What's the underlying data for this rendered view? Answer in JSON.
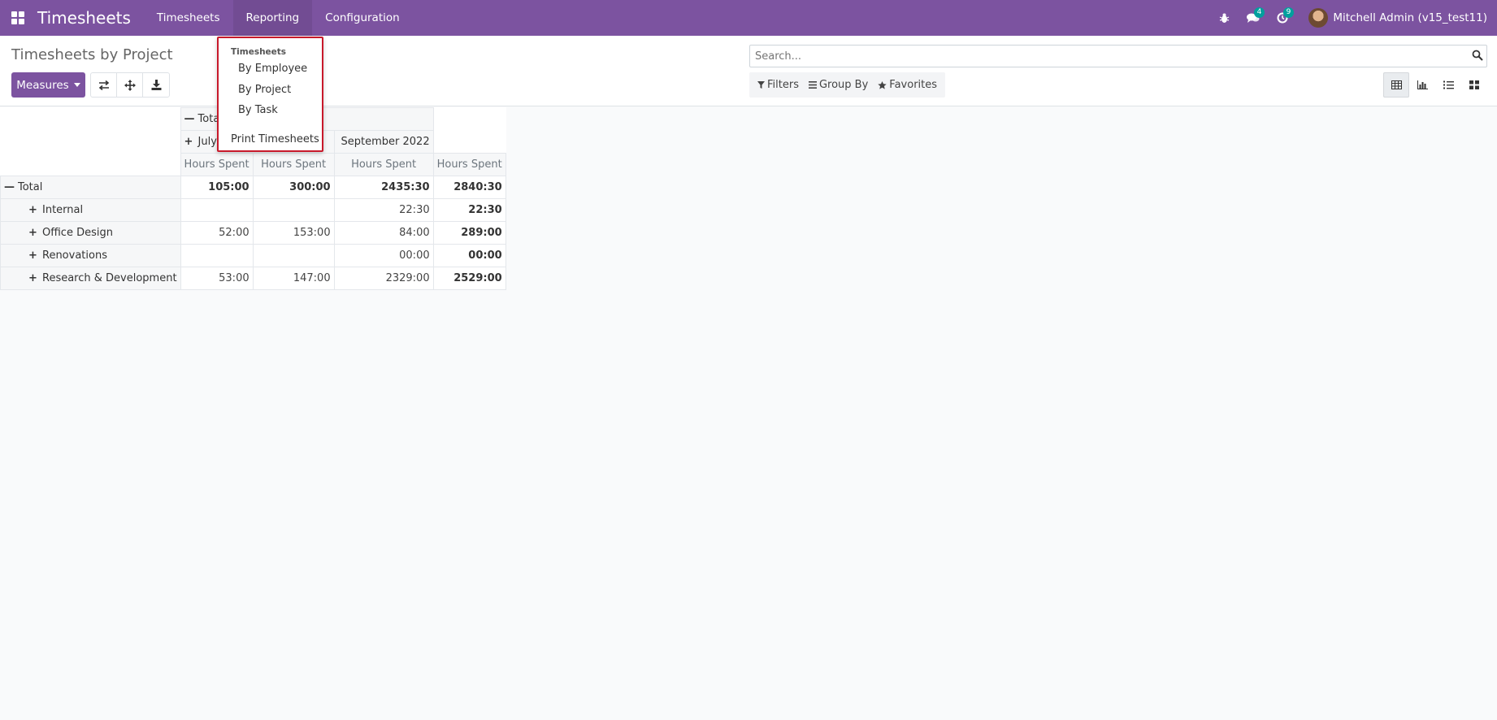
{
  "navbar": {
    "app_title": "Timesheets",
    "menu": [
      {
        "label": "Timesheets"
      },
      {
        "label": "Reporting"
      },
      {
        "label": "Configuration"
      }
    ],
    "messages_count": "4",
    "activities_count": "9",
    "user_name": "Mitchell Admin (v15_test11)",
    "accent_color": "#7c53a0"
  },
  "control_panel": {
    "title": "Timesheets by Project",
    "measures_label": "Measures",
    "search_placeholder": "Search...",
    "filters_label": "Filters",
    "group_by_label": "Group By",
    "favorites_label": "Favorites"
  },
  "reporting_menu": {
    "section": "Timesheets",
    "items": [
      "By Employee",
      "By Project",
      "By Task"
    ],
    "print_label": "Print Timesheets"
  },
  "pivot": {
    "col_total_label": "Total",
    "col_groups": [
      "July 20",
      "September 2022"
    ],
    "measure_label": "Hours Spent",
    "rows": [
      {
        "label": "Total",
        "values": [
          "105:00",
          "300:00",
          "2435:30",
          "2840:30"
        ]
      },
      {
        "label": "Internal",
        "values": [
          "",
          "",
          "22:30",
          "22:30"
        ]
      },
      {
        "label": "Office Design",
        "values": [
          "52:00",
          "153:00",
          "84:00",
          "289:00"
        ]
      },
      {
        "label": "Renovations",
        "values": [
          "",
          "",
          "00:00",
          "00:00"
        ]
      },
      {
        "label": "Research & Development",
        "values": [
          "53:00",
          "147:00",
          "2329:00",
          "2529:00"
        ]
      }
    ]
  }
}
